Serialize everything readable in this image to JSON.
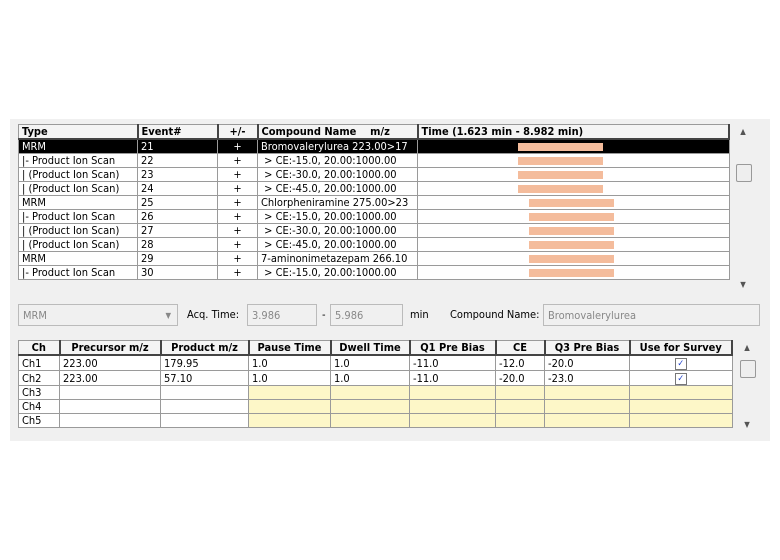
{
  "events": {
    "columns": [
      "Type",
      "Event#",
      "+/-",
      "Compound Name    m/z",
      "Time (1.623 min - 8.982 min)"
    ],
    "time_range": [
      1.623,
      8.982
    ],
    "rows": [
      {
        "type": "MRM",
        "event": "21",
        "pol": "+",
        "name": "Bromovalerylurea 223.00>17",
        "start": 3.986,
        "end": 5.986,
        "selected": true
      },
      {
        "type": "|- Product Ion Scan",
        "event": "22",
        "pol": "+",
        "name": " > CE:-15.0, 20.00:1000.00",
        "start": 3.986,
        "end": 5.986
      },
      {
        "type": "| (Product Ion Scan)",
        "event": "23",
        "pol": "+",
        "name": " > CE:-30.0, 20.00:1000.00",
        "start": 3.986,
        "end": 5.986
      },
      {
        "type": "| (Product Ion Scan)",
        "event": "24",
        "pol": "+",
        "name": " > CE:-45.0, 20.00:1000.00",
        "start": 3.986,
        "end": 5.986
      },
      {
        "type": "MRM",
        "event": "25",
        "pol": "+",
        "name": "Chlorpheniramine 275.00>23",
        "start": 4.25,
        "end": 6.25
      },
      {
        "type": "|- Product Ion Scan",
        "event": "26",
        "pol": "+",
        "name": " > CE:-15.0, 20.00:1000.00",
        "start": 4.25,
        "end": 6.25
      },
      {
        "type": "| (Product Ion Scan)",
        "event": "27",
        "pol": "+",
        "name": " > CE:-30.0, 20.00:1000.00",
        "start": 4.25,
        "end": 6.25
      },
      {
        "type": "| (Product Ion Scan)",
        "event": "28",
        "pol": "+",
        "name": " > CE:-45.0, 20.00:1000.00",
        "start": 4.25,
        "end": 6.25
      },
      {
        "type": "MRM",
        "event": "29",
        "pol": "+",
        "name": "7-aminonimetazepam 266.10",
        "start": 4.25,
        "end": 6.25
      },
      {
        "type": "|- Product Ion Scan",
        "event": "30",
        "pol": "+",
        "name": " > CE:-15.0, 20.00:1000.00",
        "start": 4.25,
        "end": 6.25
      }
    ]
  },
  "controls": {
    "type_select": "MRM",
    "acq_label": "Acq. Time:",
    "acq_start": "3.986",
    "dash": "-",
    "acq_end": "5.986",
    "unit": "min",
    "compound_label": "Compound Name:",
    "compound": "Bromovalerylurea"
  },
  "channels": {
    "columns": [
      "Ch",
      "Precursor m/z",
      "Product m/z",
      "Pause Time",
      "Dwell Time",
      "Q1 Pre Bias",
      "CE",
      "Q3 Pre Bias",
      "Use for Survey"
    ],
    "rows": [
      {
        "ch": "Ch1",
        "cells": [
          "223.00",
          "179.95",
          "1.0",
          "1.0",
          "-11.0",
          "-12.0",
          "-20.0"
        ],
        "survey": true
      },
      {
        "ch": "Ch2",
        "cells": [
          "223.00",
          "57.10",
          "1.0",
          "1.0",
          "-11.0",
          "-20.0",
          "-23.0"
        ],
        "survey": true
      },
      {
        "ch": "Ch3",
        "cells": [
          "",
          "",
          "",
          "",
          "",
          "",
          ""
        ],
        "survey": false,
        "empty": true
      },
      {
        "ch": "Ch4",
        "cells": [
          "",
          "",
          "",
          "",
          "",
          "",
          ""
        ],
        "survey": false,
        "empty": true
      },
      {
        "ch": "Ch5",
        "cells": [
          "",
          "",
          "",
          "",
          "",
          "",
          ""
        ],
        "survey": false,
        "empty": true
      }
    ]
  },
  "colors": {
    "bar": "#f4bc9c",
    "empty_cell": "#fdf7c8",
    "selected_row": "#000000"
  }
}
